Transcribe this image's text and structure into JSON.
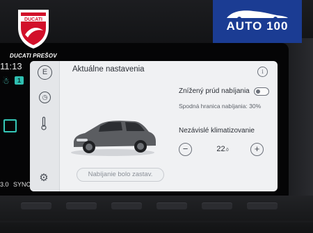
{
  "overlay": {
    "ducati_brand": "DUCATI",
    "ducati_caption": "DUCATI PREŠOV",
    "auto_badge": "AUTO 100"
  },
  "status_bar": {
    "clock": "11:13",
    "person_count": "1",
    "temperature": "3.0",
    "sync_label": "SYNC"
  },
  "app": {
    "title": "Aktuálne nastavenia",
    "reduced_current": {
      "label": "Znížený prúd nabíjania",
      "enabled": false
    },
    "charge_limit_label": "Spodná hranica nabíjania: 30%",
    "climate": {
      "label": "Nezávislé klimatizovanie",
      "decrease_label": "−",
      "increase_label": "+",
      "temperature_value": "22",
      "temperature_decimal": ".0"
    },
    "status_pill": "Nabíjanie bolo zastav.",
    "rail_icons": [
      "e-mode-icon",
      "clock-icon",
      "thermometer-icon",
      "settings-icon"
    ]
  },
  "colors": {
    "accent_teal": "#35c8b8",
    "badge_blue": "#1b3c93",
    "ducati_red": "#d2102a",
    "panel_bg": "#f0f1f3"
  }
}
